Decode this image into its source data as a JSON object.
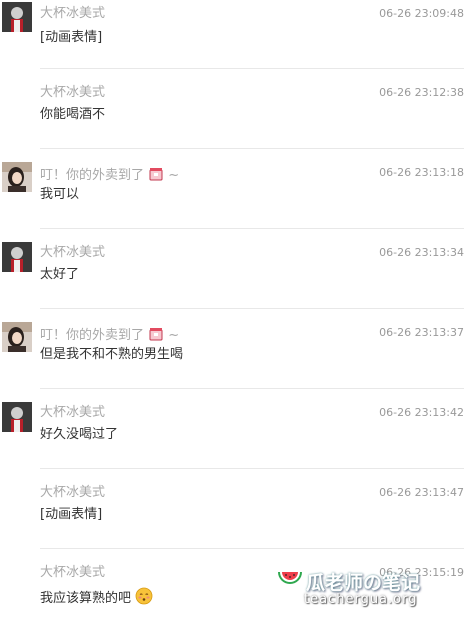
{
  "messages": [
    {
      "avatar": "portrait-red",
      "sender": "大杯冰美式",
      "sender_emoji": "",
      "time": "06-26 23:09:48",
      "text": "[动画表情]",
      "text_emoji": ""
    },
    {
      "avatar": "",
      "sender": "大杯冰美式",
      "sender_emoji": "",
      "time": "06-26 23:12:38",
      "text": "你能喝酒不",
      "text_emoji": ""
    },
    {
      "avatar": "portrait-girl",
      "sender": "叮！你的外卖到了",
      "sender_emoji": "takeout-box-emoji",
      "sender_suffix": "~",
      "time": "06-26 23:13:18",
      "text": "我可以",
      "text_emoji": ""
    },
    {
      "avatar": "portrait-red",
      "sender": "大杯冰美式",
      "sender_emoji": "",
      "time": "06-26 23:13:34",
      "text": "太好了",
      "text_emoji": ""
    },
    {
      "avatar": "portrait-girl",
      "sender": "叮！你的外卖到了",
      "sender_emoji": "takeout-box-emoji",
      "sender_suffix": "~",
      "time": "06-26 23:13:37",
      "text": "但是我不和不熟的男生喝",
      "text_emoji": ""
    },
    {
      "avatar": "portrait-red",
      "sender": "大杯冰美式",
      "sender_emoji": "",
      "time": "06-26 23:13:42",
      "text": "好久没喝过了",
      "text_emoji": ""
    },
    {
      "avatar": "",
      "sender": "大杯冰美式",
      "sender_emoji": "",
      "time": "06-26 23:13:47",
      "text": "[动画表情]",
      "text_emoji": ""
    },
    {
      "avatar": "",
      "sender": "大杯冰美式",
      "sender_emoji": "",
      "time": "06-26 23:15:19",
      "text": "我应该算熟的吧",
      "text_emoji": "blushing-face-emoji"
    }
  ],
  "watermark": {
    "logo_icon": "watermelon-icon",
    "title": "瓜老师の笔记",
    "url": "teachergua.org"
  }
}
